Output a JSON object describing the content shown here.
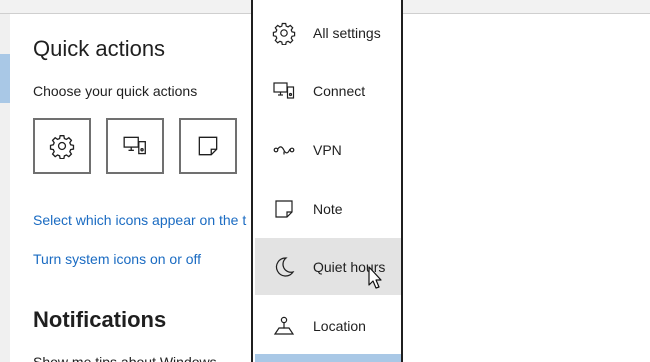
{
  "settings": {
    "quick_actions_heading": "Quick actions",
    "choose_label": "Choose your quick actions",
    "tiles": [
      {
        "icon": "gear-icon"
      },
      {
        "icon": "connect-icon"
      },
      {
        "icon": "note-icon"
      }
    ],
    "link_select_icons": "Select which icons appear on the t",
    "link_system_icons": "Turn system icons on or off",
    "notifications_heading": "Notifications",
    "notifications_first_line": "Show me tips about Windows"
  },
  "popup": {
    "items": [
      {
        "label": "All settings",
        "icon": "gear-icon"
      },
      {
        "label": "Connect",
        "icon": "connect-icon"
      },
      {
        "label": "VPN",
        "icon": "vpn-icon"
      },
      {
        "label": "Note",
        "icon": "note-icon"
      },
      {
        "label": "Quiet hours",
        "icon": "moon-icon"
      },
      {
        "label": "Location",
        "icon": "location-icon"
      }
    ],
    "highlighted_item": "Quiet hours"
  },
  "colors": {
    "link": "#1a6bc2",
    "highlight": "#e3e3e3",
    "accent": "#a9c8e6",
    "border": "#1f1f1f"
  }
}
